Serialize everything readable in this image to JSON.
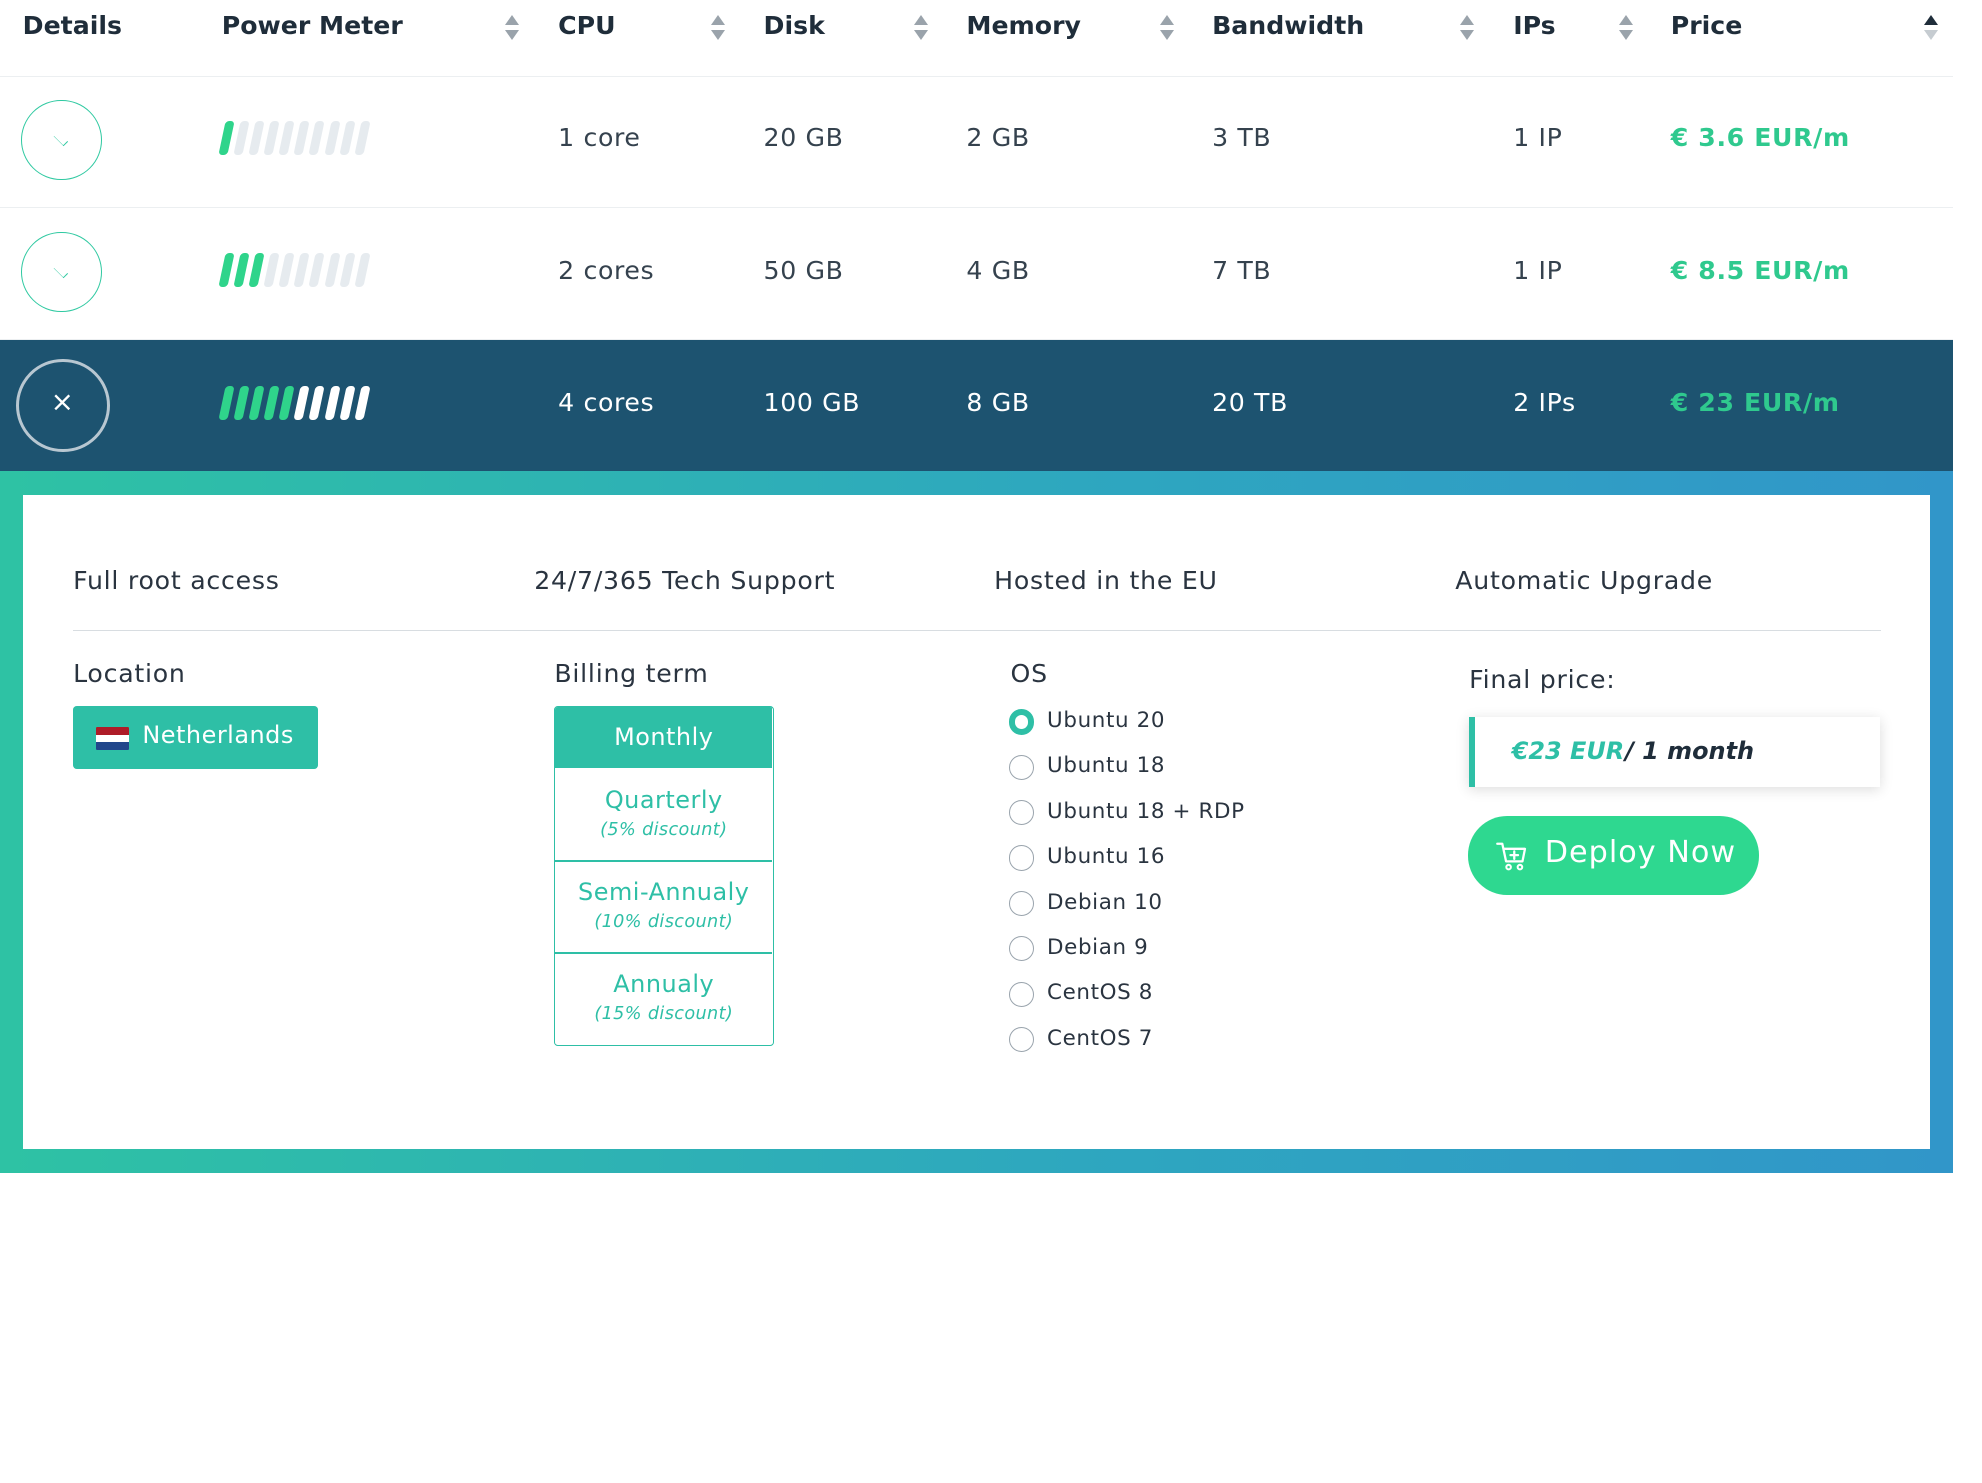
{
  "header": {
    "details": "Details",
    "power_meter": "Power Meter",
    "cpu": "CPU",
    "disk": "Disk",
    "memory": "Memory",
    "bandwidth": "Bandwidth",
    "ips": "IPs",
    "price": "Price"
  },
  "plans": [
    {
      "power_level": 1,
      "power_max": 10,
      "cpu": "1 core",
      "disk": "20 GB",
      "memory": "2 GB",
      "bandwidth": "3 TB",
      "ips": "1 IP",
      "price": "€ 3.6 EUR/m",
      "expanded": false
    },
    {
      "power_level": 3,
      "power_max": 10,
      "cpu": "2 cores",
      "disk": "50 GB",
      "memory": "4 GB",
      "bandwidth": "7 TB",
      "ips": "1 IP",
      "price": "€ 8.5 EUR/m",
      "expanded": false
    },
    {
      "power_level": 5,
      "power_max": 10,
      "cpu": "4 cores",
      "disk": "100 GB",
      "memory": "8 GB",
      "bandwidth": "20 TB",
      "ips": "2 IPs",
      "price": "€ 23 EUR/m",
      "expanded": true
    }
  ],
  "close_glyph": "×",
  "details": {
    "features": [
      "Full root access",
      "24/7/365 Tech Support",
      "Hosted in the EU",
      "Automatic Upgrade"
    ],
    "location_label": "Location",
    "location_value": "Netherlands",
    "billing_label": "Billing term",
    "billing_options": [
      {
        "name": "Monthly",
        "discount": "",
        "selected": true
      },
      {
        "name": "Quarterly",
        "discount": "(5% discount)",
        "selected": false
      },
      {
        "name": "Semi-Annualy",
        "discount": "(10% discount)",
        "selected": false
      },
      {
        "name": "Annualy",
        "discount": "(15% discount)",
        "selected": false
      }
    ],
    "os_label": "OS",
    "os_options": [
      {
        "name": "Ubuntu 20",
        "selected": true
      },
      {
        "name": "Ubuntu 18",
        "selected": false
      },
      {
        "name": "Ubuntu 18 + RDP",
        "selected": false
      },
      {
        "name": "Ubuntu 16",
        "selected": false
      },
      {
        "name": "Debian 10",
        "selected": false
      },
      {
        "name": "Debian 9",
        "selected": false
      },
      {
        "name": "CentOS 8",
        "selected": false
      },
      {
        "name": "CentOS 7",
        "selected": false
      }
    ],
    "final_price_label": "Final price:",
    "final_price_value": "€23 EUR",
    "final_price_period": "/ 1 month",
    "deploy_label": "Deploy Now"
  },
  "colors": {
    "accent": "#2ebfa6",
    "price_green": "#2fc98e",
    "selected_row_bg": "#1d5370",
    "deploy_bg": "#2ed890"
  },
  "icons": {
    "expand": "chevron-down-icon",
    "close": "close-icon",
    "sort": "sort-icon",
    "flag": "netherlands-flag-icon",
    "cart": "cart-icon"
  }
}
